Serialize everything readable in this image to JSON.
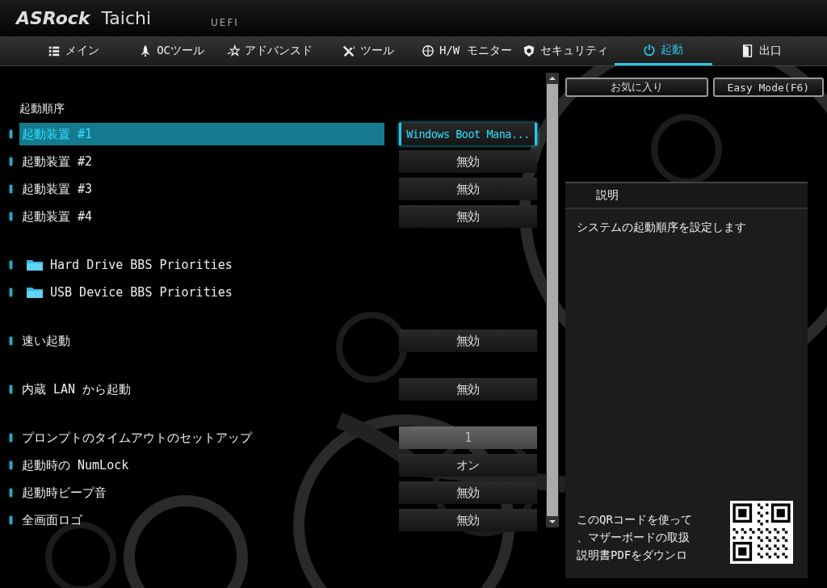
{
  "header": {
    "brand": "ASRock",
    "model": "Taichi",
    "firmware": "UEFI"
  },
  "tabs": [
    {
      "label": "メイン",
      "selected": false
    },
    {
      "label": "OCツール",
      "selected": false
    },
    {
      "label": "アドバンスド",
      "selected": false
    },
    {
      "label": "ツール",
      "selected": false
    },
    {
      "label": "H/W モニター",
      "selected": false
    },
    {
      "label": "セキュリティ",
      "selected": false
    },
    {
      "label": "起動",
      "selected": true
    },
    {
      "label": "出口",
      "selected": false
    }
  ],
  "top_buttons": [
    "お気に入り",
    "Easy Mode(F6)"
  ],
  "settings": {
    "heading": "起動順序",
    "groups": [
      {
        "items": [
          {
            "kind": "option",
            "label": "起動装置 #1",
            "value": "Windows Boot Mana...",
            "selected": true
          },
          {
            "kind": "option",
            "label": "起動装置 #2",
            "value": "無効",
            "selected": false
          },
          {
            "kind": "option",
            "label": "起動装置 #3",
            "value": "無効",
            "selected": false
          },
          {
            "kind": "option",
            "label": "起動装置 #4",
            "value": "無効",
            "selected": false
          }
        ]
      },
      {
        "items": [
          {
            "kind": "folder",
            "label": "Hard Drive BBS Priorities"
          },
          {
            "kind": "folder",
            "label": "USB Device BBS Priorities"
          }
        ]
      },
      {
        "items": [
          {
            "kind": "option",
            "label": "速い起動",
            "value": "無効",
            "selected": false
          }
        ]
      },
      {
        "items": [
          {
            "kind": "option",
            "label": "内蔵 LAN  から起動",
            "value": "無効",
            "selected": false
          }
        ]
      },
      {
        "items": [
          {
            "kind": "number",
            "label": "プロンプトのタイムアウトのセットアップ",
            "value": "1",
            "selected": false
          },
          {
            "kind": "option",
            "label": "起動時の NumLock",
            "value": "オン",
            "selected": false
          },
          {
            "kind": "option",
            "label": "起動時ビープ音",
            "value": "無効",
            "selected": false
          },
          {
            "kind": "option",
            "label": "全画面ロゴ",
            "value": "無効",
            "selected": false
          }
        ]
      }
    ]
  },
  "description": {
    "title": "説明",
    "text": "システムの起動順序を設定します",
    "qr_text_lines": [
      "このQRコードを使って",
      "、マザーボードの取扱",
      "説明書PDFをダウンロ"
    ]
  }
}
